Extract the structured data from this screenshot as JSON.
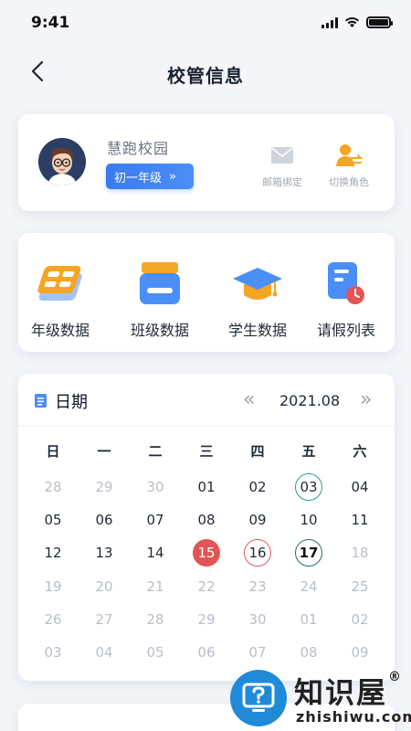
{
  "status_bar": {
    "time": "9:41"
  },
  "nav": {
    "title": "校管信息"
  },
  "profile": {
    "school_name": "慧跑校园",
    "grade_label": "初一年级",
    "grade_chevron": "»",
    "mail_label": "邮箱绑定",
    "switch_label": "切换角色"
  },
  "quick_actions": [
    {
      "label": "年级数据",
      "icon": "grade-data-icon"
    },
    {
      "label": "班级数据",
      "icon": "class-data-icon"
    },
    {
      "label": "学生数据",
      "icon": "student-data-icon"
    },
    {
      "label": "请假列表",
      "icon": "leave-list-icon"
    }
  ],
  "calendar": {
    "title": "日期",
    "prev": "«",
    "month": "2021.08",
    "next": "»",
    "weekdays": [
      "日",
      "一",
      "二",
      "三",
      "四",
      "五",
      "六"
    ],
    "days": [
      {
        "d": "28",
        "s": "muted"
      },
      {
        "d": "29",
        "s": "muted"
      },
      {
        "d": "30",
        "s": "muted"
      },
      {
        "d": "01",
        "s": "normal"
      },
      {
        "d": "02",
        "s": "normal"
      },
      {
        "d": "03",
        "s": "ring-green"
      },
      {
        "d": "04",
        "s": "normal"
      },
      {
        "d": "05",
        "s": "normal"
      },
      {
        "d": "06",
        "s": "normal"
      },
      {
        "d": "07",
        "s": "normal"
      },
      {
        "d": "08",
        "s": "normal"
      },
      {
        "d": "09",
        "s": "normal"
      },
      {
        "d": "10",
        "s": "normal"
      },
      {
        "d": "11",
        "s": "normal"
      },
      {
        "d": "12",
        "s": "normal"
      },
      {
        "d": "13",
        "s": "normal"
      },
      {
        "d": "14",
        "s": "normal"
      },
      {
        "d": "15",
        "s": "fill-red"
      },
      {
        "d": "16",
        "s": "ring-red"
      },
      {
        "d": "17",
        "s": "ring-dark"
      },
      {
        "d": "18",
        "s": "muted"
      },
      {
        "d": "19",
        "s": "muted"
      },
      {
        "d": "20",
        "s": "muted"
      },
      {
        "d": "21",
        "s": "muted"
      },
      {
        "d": "22",
        "s": "muted"
      },
      {
        "d": "23",
        "s": "muted"
      },
      {
        "d": "24",
        "s": "muted"
      },
      {
        "d": "25",
        "s": "muted"
      },
      {
        "d": "26",
        "s": "muted"
      },
      {
        "d": "27",
        "s": "muted"
      },
      {
        "d": "28",
        "s": "muted"
      },
      {
        "d": "29",
        "s": "muted"
      },
      {
        "d": "30",
        "s": "muted"
      },
      {
        "d": "01",
        "s": "muted"
      },
      {
        "d": "02",
        "s": "muted"
      },
      {
        "d": "03",
        "s": "muted"
      },
      {
        "d": "04",
        "s": "muted"
      },
      {
        "d": "05",
        "s": "muted"
      },
      {
        "d": "06",
        "s": "muted"
      },
      {
        "d": "07",
        "s": "muted"
      },
      {
        "d": "08",
        "s": "muted"
      },
      {
        "d": "09",
        "s": "muted"
      }
    ]
  },
  "watermark": {
    "name": "知识屋",
    "reg": "®",
    "domain": "zhishiwu.com"
  },
  "colors": {
    "accent": "#3a7bf0",
    "today": "#e35454",
    "ring_green": "#2a9d8f",
    "muted": "#b9bec7"
  }
}
